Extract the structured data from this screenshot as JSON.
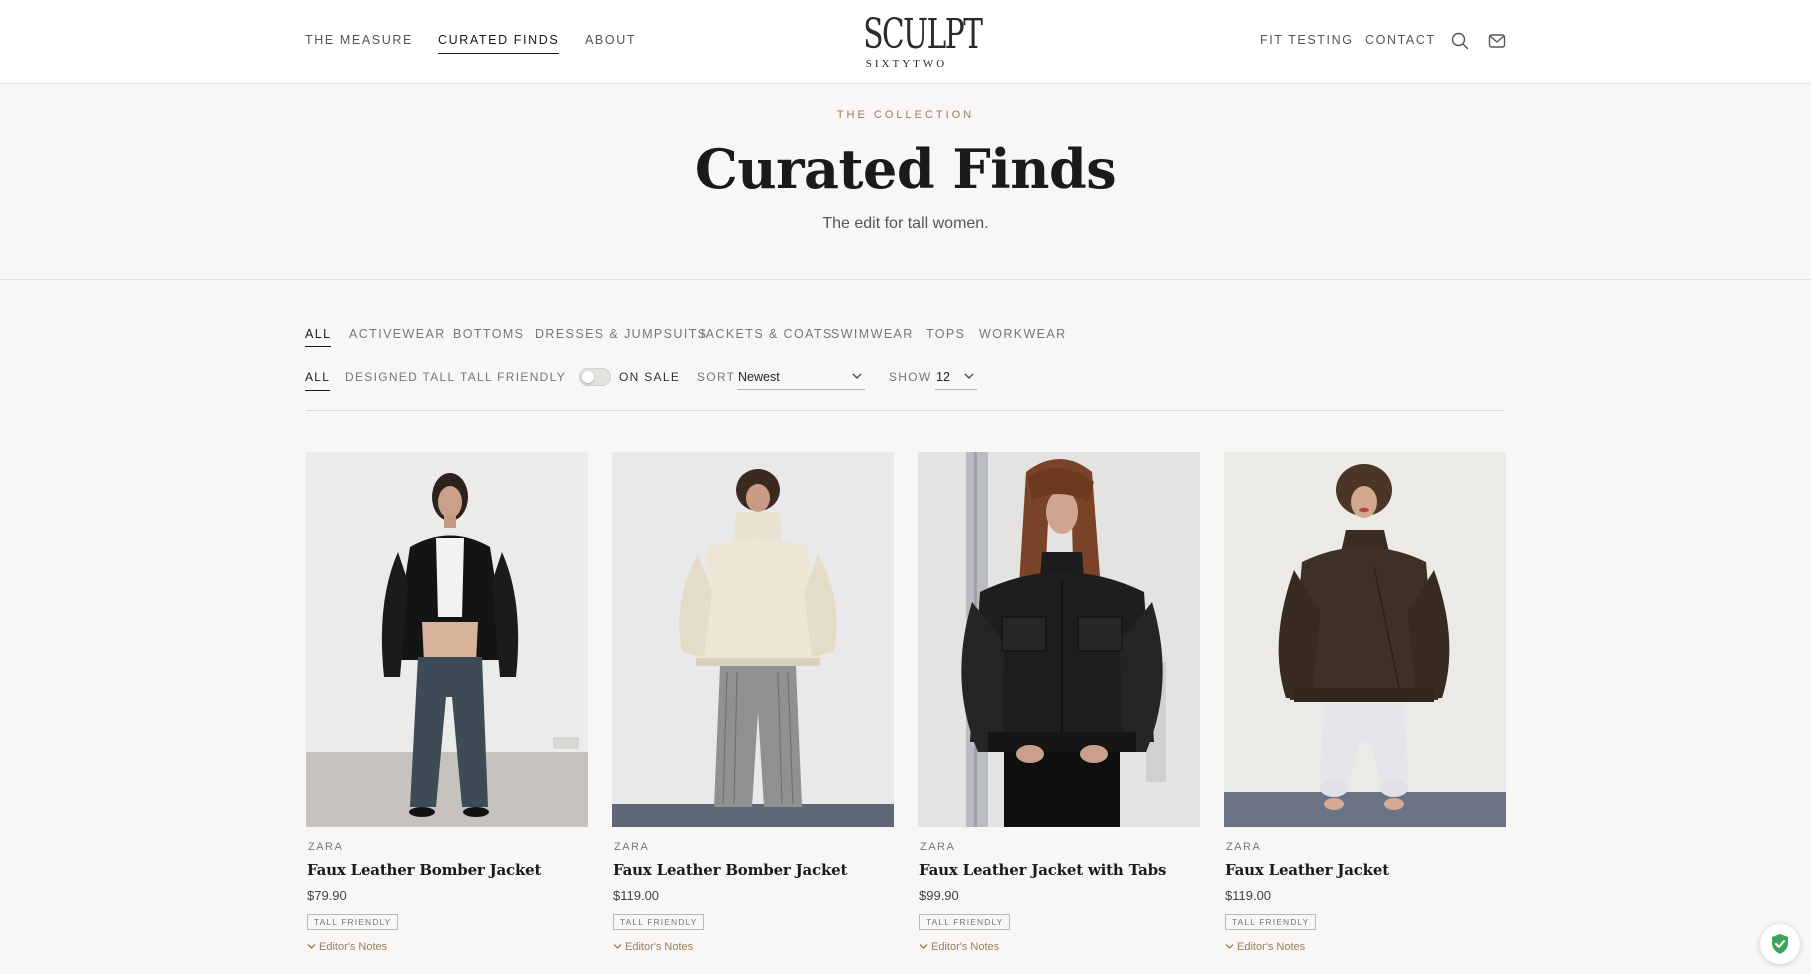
{
  "header": {
    "nav_left": [
      {
        "label": "THE MEASURE",
        "active": false
      },
      {
        "label": "CURATED FINDS",
        "active": true
      },
      {
        "label": "ABOUT",
        "active": false
      }
    ],
    "logo": {
      "main": "SCULPT",
      "sub": "SIXTYTWO"
    },
    "nav_right": [
      {
        "label": "FIT TESTING"
      },
      {
        "label": "CONTACT"
      }
    ],
    "icons": [
      "search-icon",
      "mail-icon"
    ]
  },
  "hero": {
    "eyebrow": "THE COLLECTION",
    "title": "Curated Finds",
    "subtitle": "The edit for tall women."
  },
  "filters": {
    "categories": [
      {
        "label": "ALL",
        "active": true
      },
      {
        "label": "ACTIVEWEAR"
      },
      {
        "label": "BOTTOMS"
      },
      {
        "label": "DRESSES & JUMPSUITS"
      },
      {
        "label": "JACKETS & COATS"
      },
      {
        "label": "SWIMWEAR"
      },
      {
        "label": "TOPS"
      },
      {
        "label": "WORKWEAR"
      }
    ],
    "fit_types": [
      {
        "label": "ALL",
        "active": true
      },
      {
        "label": "DESIGNED TALL"
      },
      {
        "label": "TALL FRIENDLY"
      }
    ],
    "on_sale": {
      "label": "ON SALE",
      "checked": false
    },
    "sort": {
      "label": "SORT",
      "value": "Newest"
    },
    "show": {
      "label": "SHOW",
      "value": "12"
    }
  },
  "products": [
    {
      "brand": "ZARA",
      "name": "Faux Leather Bomber Jacket",
      "price": "$79.90",
      "badge": "TALL FRIENDLY",
      "notes": "Editor's Notes",
      "image": "model in black faux leather bomber and flared jeans"
    },
    {
      "brand": "ZARA",
      "name": "Faux Leather Bomber Jacket",
      "price": "$119.00",
      "badge": "TALL FRIENDLY",
      "notes": "Editor's Notes",
      "image": "model in cream funnel-neck bomber and striped trousers"
    },
    {
      "brand": "ZARA",
      "name": "Faux Leather Jacket with Tabs",
      "price": "$99.90",
      "badge": "TALL FRIENDLY",
      "notes": "Editor's Notes",
      "image": "model in black cropped faux leather jacket"
    },
    {
      "brand": "ZARA",
      "name": "Faux Leather Jacket",
      "price": "$119.00",
      "badge": "TALL FRIENDLY",
      "notes": "Editor's Notes",
      "image": "model in brown oversized faux leather jacket"
    }
  ],
  "floating": {
    "icon": "shield-check-icon"
  },
  "colors": {
    "accent": "#9a7d5b",
    "text": "#1a1a1a",
    "page_bg": "#f8f7f5",
    "header_bg": "#ffffff"
  }
}
